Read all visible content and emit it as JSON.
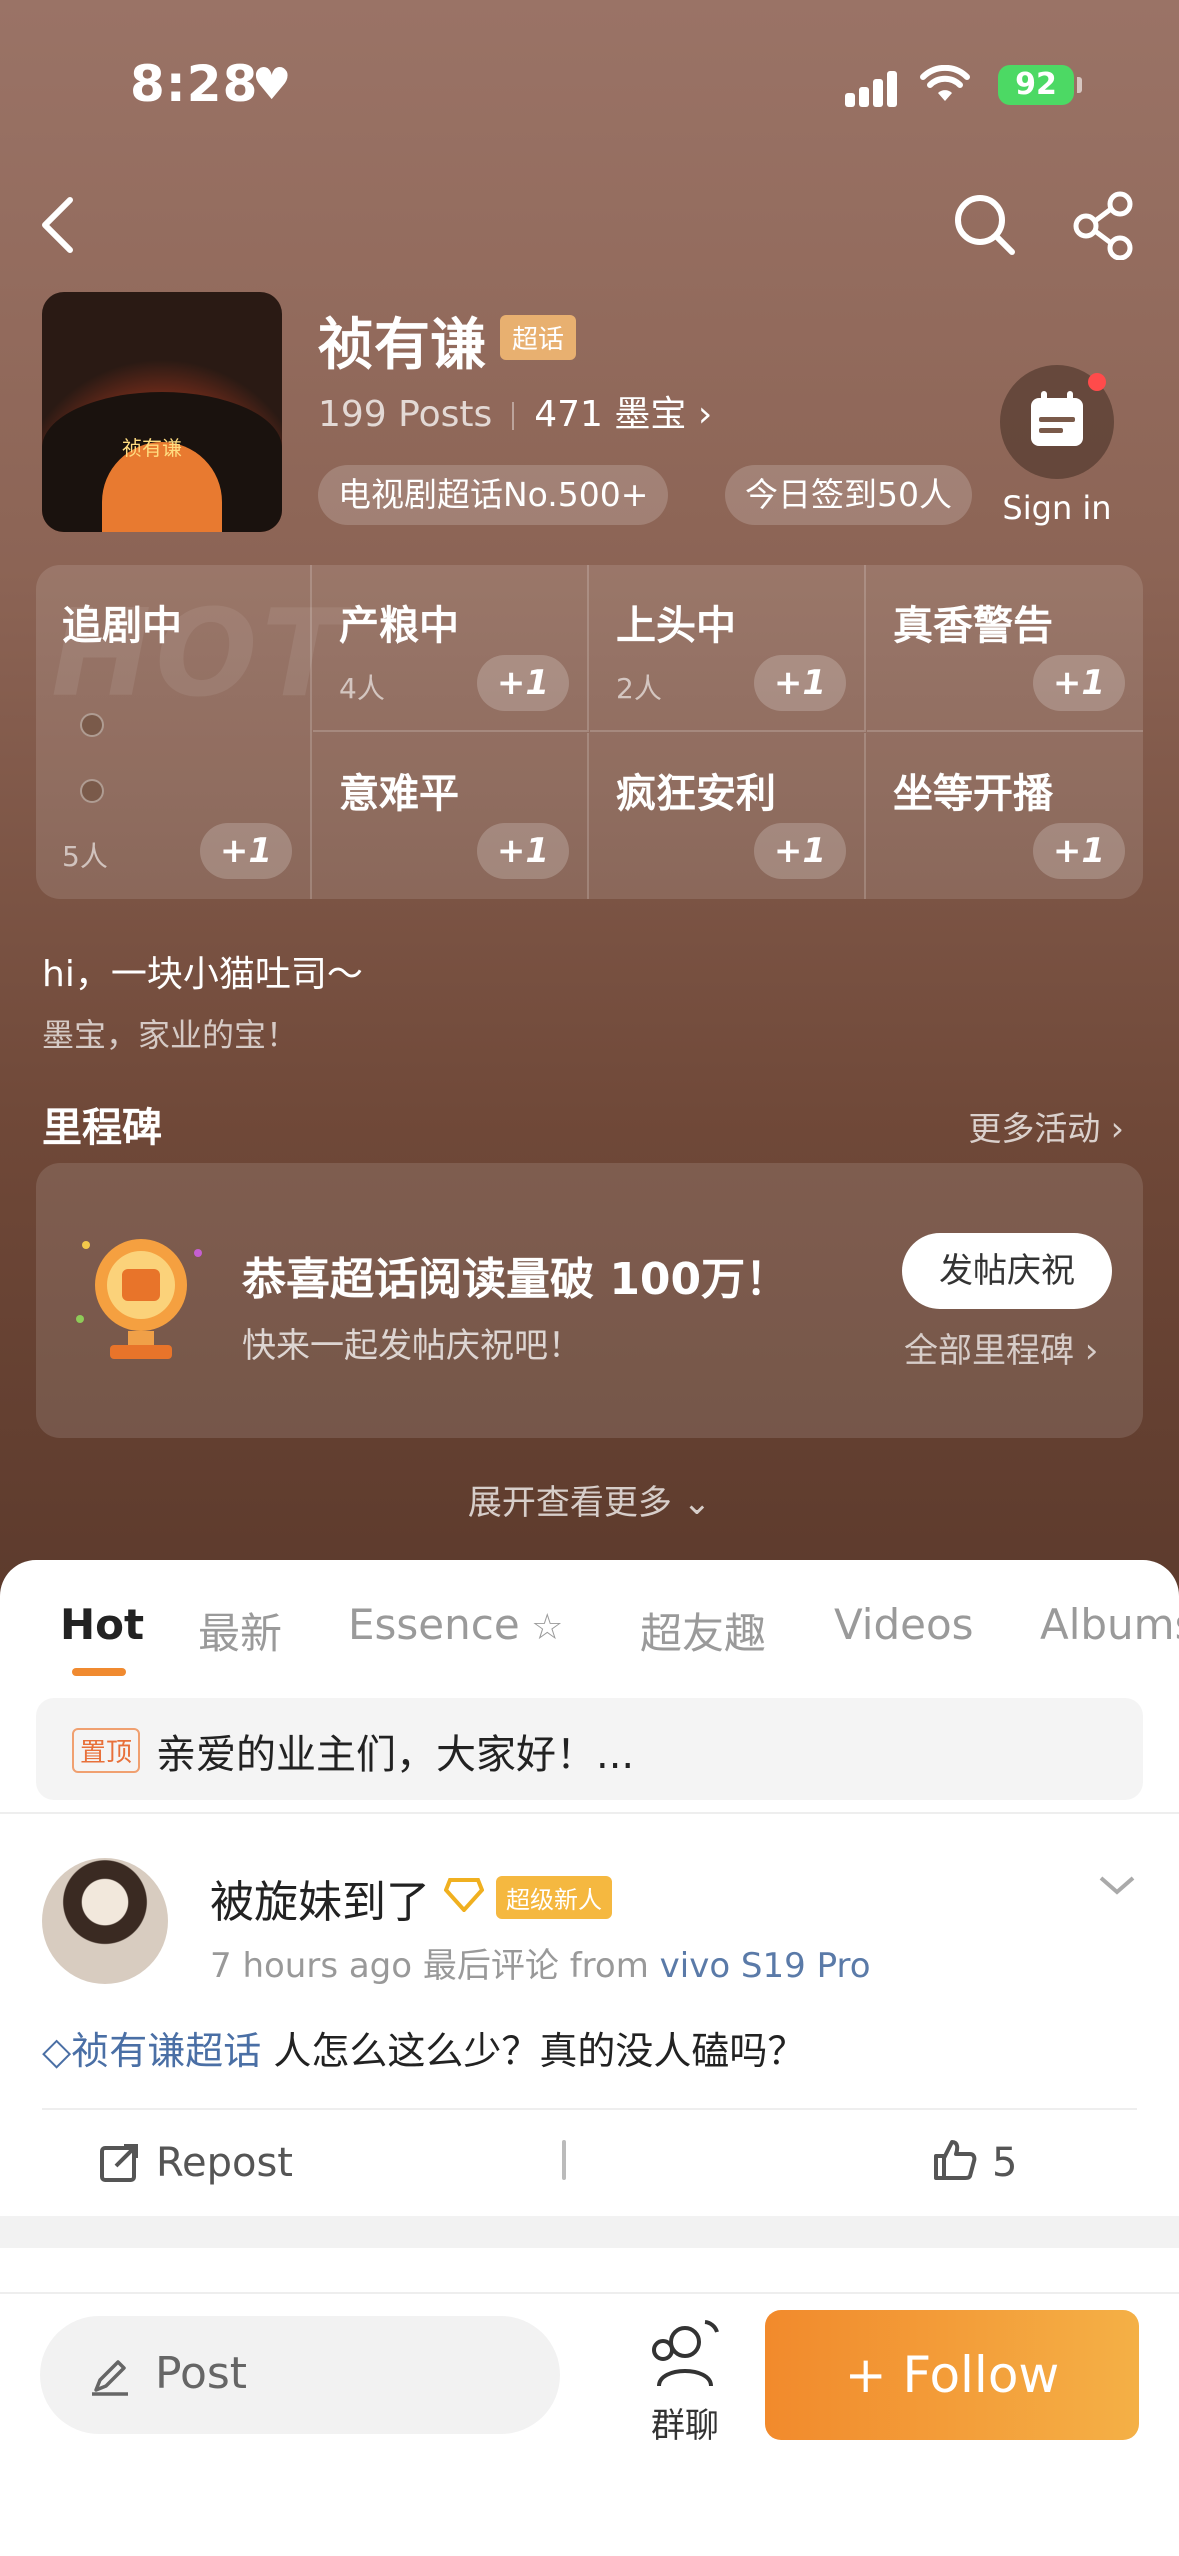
{
  "status_bar": {
    "time": "8:28",
    "battery": "92"
  },
  "header": {
    "title": "祯有谦",
    "badge": "超话",
    "posts": "199 Posts",
    "mobao": "471 墨宝",
    "avatar_text": "祯有谦",
    "chips": [
      "电视剧超话No.500+",
      "今日签到50人"
    ],
    "sign_in": "Sign in"
  },
  "grid": {
    "watermark": "HOT",
    "cells": [
      {
        "label": "追剧中",
        "count": "5人",
        "plus": "+1"
      },
      {
        "label": "产粮中",
        "count": "4人",
        "plus": "+1"
      },
      {
        "label": "上头中",
        "count": "2人",
        "plus": "+1"
      },
      {
        "label": "真香警告",
        "plus": "+1"
      },
      {
        "label": "意难平",
        "plus": "+1"
      },
      {
        "label": "疯狂安利",
        "plus": "+1"
      },
      {
        "label": "坐等开播",
        "plus": "+1"
      }
    ]
  },
  "intro": {
    "line1": "hi，一块小猫吐司～",
    "line2": "墨宝，家业的宝！"
  },
  "milestone": {
    "title": "里程碑",
    "more": "更多活动",
    "headline": "恭喜超话阅读量破 100万！",
    "sub": "快来一起发帖庆祝吧！",
    "button": "发帖庆祝",
    "all": "全部里程碑"
  },
  "expand": "展开查看更多",
  "tabs": [
    "Hot",
    "最新",
    "Essence",
    "超友趣",
    "Videos",
    "Albums"
  ],
  "pinned": {
    "tag": "置顶",
    "text": "亲爱的业主们，大家好！..."
  },
  "post": {
    "name": "被旋妹到了",
    "badge": "超级新人",
    "meta_time": "7 hours ago 最后评论",
    "meta_from": "from",
    "meta_device": "vivo S19 Pro",
    "topic": "祯有谦超话",
    "body": " 人怎么这么少？真的没人磕吗？",
    "repost": "Repost",
    "likes": "5"
  },
  "bottom": {
    "post_placeholder": "Post",
    "group": "群聊",
    "follow": "+ Follow"
  },
  "colors": {
    "accent": "#f08a30",
    "topic": "#4a6fa5",
    "battery": "#4cd964"
  }
}
